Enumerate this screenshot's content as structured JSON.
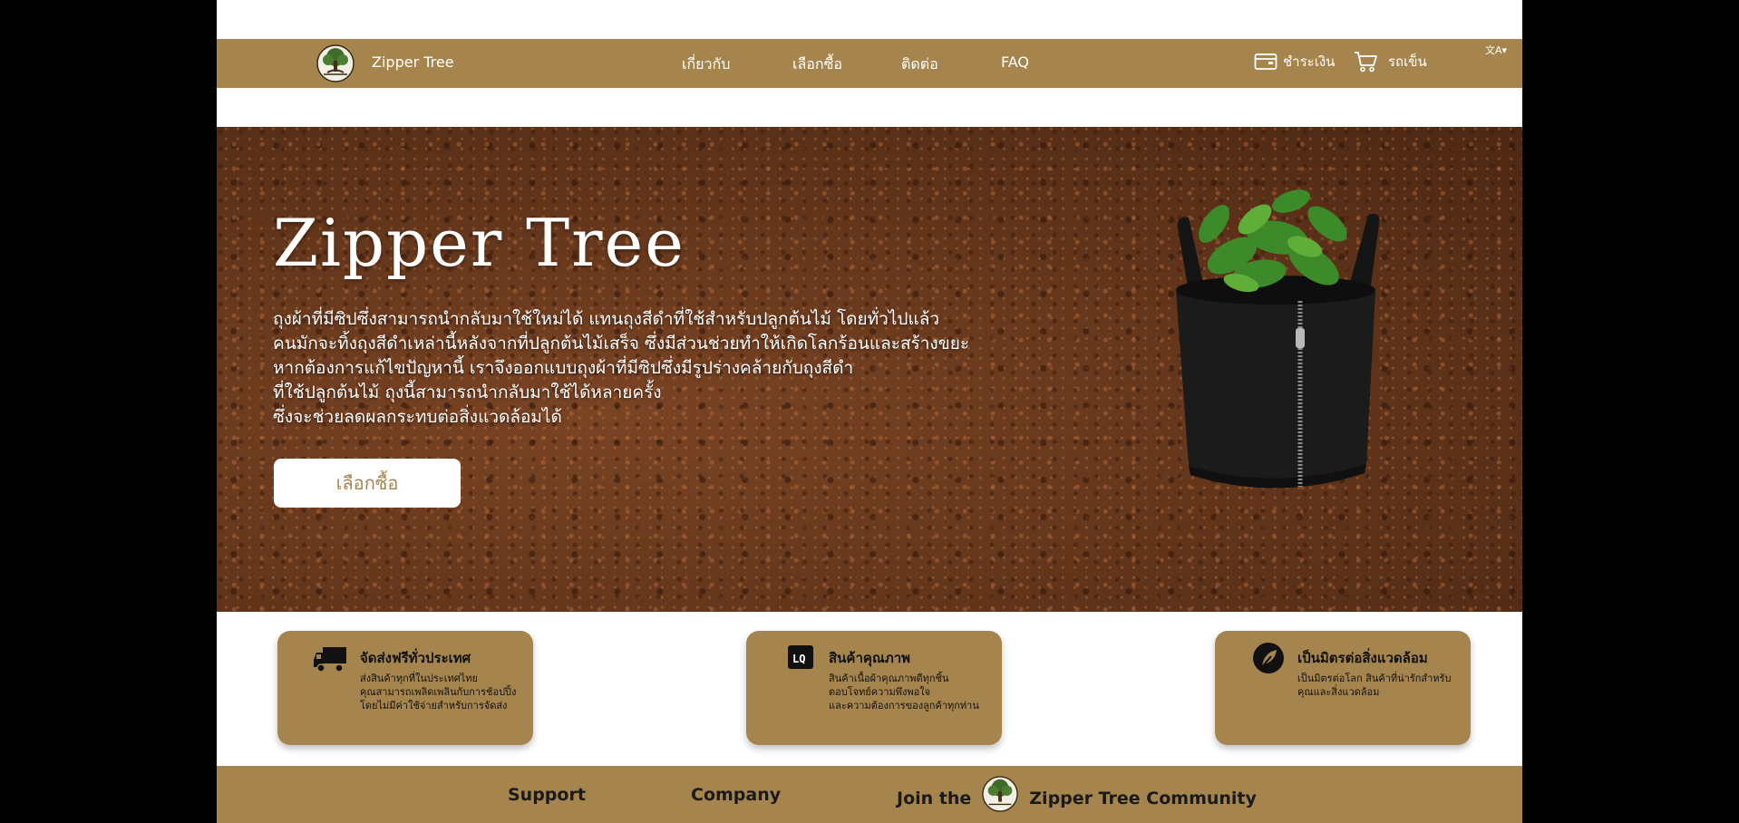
{
  "brand": {
    "name": "Zipper Tree",
    "logo_icon": "tree-logo-icon"
  },
  "nav": {
    "links": [
      "เกี่ยวกับ",
      "เลือกซื้อ",
      "ติดต่อ",
      "FAQ"
    ],
    "checkout_label": "ชำระเงิน",
    "cart_label": "รถเข็น",
    "language_icon": "translate-icon"
  },
  "hero": {
    "title": "Zipper Tree",
    "lines": [
      "ถุงผ้าที่มีซิปซึ่งสามารถนำกลับมาใช้ใหม่ได้ แทนถุงสีดำที่ใช้สำหรับปลูกต้นไม้ โดยทั่วไปแล้ว",
      "คนมักจะทิ้งถุงสีดำเหล่านี้หลังจากที่ปลูกต้นไม้เสร็จ ซึ่งมีส่วนช่วยทำให้เกิดโลกร้อนและสร้างขยะ",
      "หากต้องการแก้ไขปัญหานี้ เราจึงออกแบบถุงผ้าที่มีซิปซึ่งมีรูปร่างคล้ายกับถุงสีดำ",
      "ที่ใช้ปลูกต้นไม้ ถุงนี้สามารถนำกลับมาใช้ได้หลายครั้ง",
      "ซึ่งจะช่วยลดผลกระทบต่อสิ่งแวดล้อมได้"
    ],
    "cta_label": "เลือกซื้อ"
  },
  "features": [
    {
      "icon": "delivery-truck-icon",
      "title": "จัดส่งฟรีทั่วประเทศ",
      "desc": [
        "ส่งสินค้าทุกที่ในประเทศไทย",
        "คุณสามารถเพลิดเพลินกับการช้อปปิ้ง",
        "โดยไม่มีค่าใช้จ่ายสำหรับการจัดส่ง"
      ]
    },
    {
      "icon": "quality-badge-icon",
      "title": "สินค้าคุณภาพ",
      "desc": [
        "สินค้าเนื้อผ้าคุณภาพดีทุกชิ้น",
        "ตอบโจทย์ความพึงพอใจ",
        "และความต้องการของลูกค้าทุกท่าน"
      ]
    },
    {
      "icon": "eco-leaf-icon",
      "title": "เป็นมิตรต่อสิ่งแวดล้อม",
      "desc": [
        "เป็นมิตรต่อโลก สินค้าที่น่ารักสำหรับ",
        "คุณและสิ่งแวดล้อม"
      ]
    }
  ],
  "footer": {
    "support": "Support",
    "company": "Company",
    "join_prefix": "Join the",
    "join_suffix": "Zipper Tree Community"
  },
  "colors": {
    "accent": "#a5854d",
    "white": "#ffffff",
    "text_dark": "#111111"
  }
}
